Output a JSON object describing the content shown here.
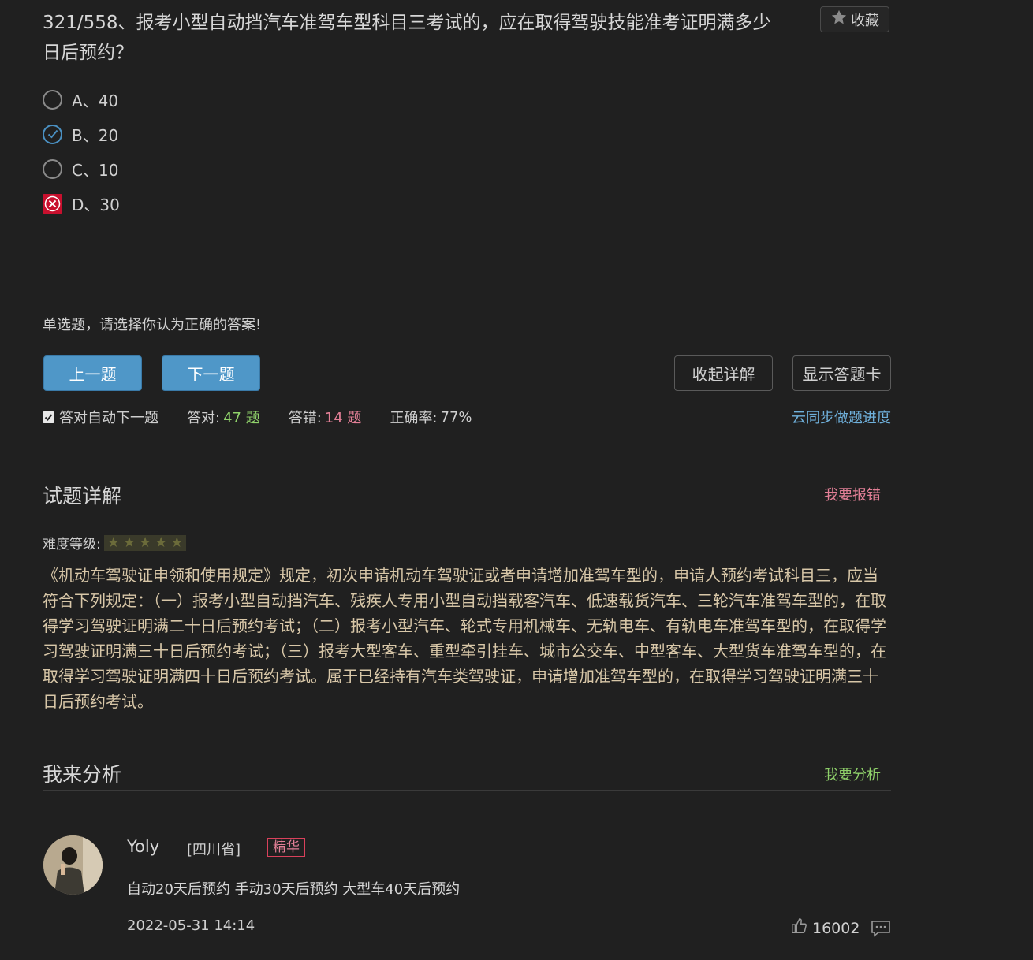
{
  "question": {
    "title": "321/558、报考小型自动挡汽车准驾车型科目三考试的，应在取得驾驶技能准考证明满多少日后预约？",
    "favorite_label": "收藏",
    "options": [
      {
        "label": "A、40",
        "state": "unselected"
      },
      {
        "label": "B、20",
        "state": "correct"
      },
      {
        "label": "C、10",
        "state": "unselected"
      },
      {
        "label": "D、30",
        "state": "wrong"
      }
    ],
    "hint": "单选题，请选择你认为正确的答案!"
  },
  "controls": {
    "prev": "上一题",
    "next": "下一题",
    "collapse": "收起详解",
    "show_card": "显示答题卡"
  },
  "stats": {
    "auto_next_label": "答对自动下一题",
    "auto_next_checked": true,
    "correct_label": "答对:",
    "correct_count": "47 题",
    "wrong_label": "答错:",
    "wrong_count": "14 题",
    "rate_label": "正确率:",
    "rate_value": "77%",
    "sync_link": "云同步做题进度"
  },
  "explanation": {
    "title": "试题详解",
    "report_link": "我要报错",
    "difficulty_label": "难度等级:",
    "difficulty_stars": 5,
    "text": "《机动车驾驶证申领和使用规定》规定，初次申请机动车驾驶证或者申请增加准驾车型的，申请人预约考试科目三，应当符合下列规定：（一）报考小型自动挡汽车、残疾人专用小型自动挡载客汽车、低速载货汽车、三轮汽车准驾车型的，在取得学习驾驶证明满二十日后预约考试；（二）报考小型汽车、轮式专用机械车、无轨电车、有轨电车准驾车型的，在取得学习驾驶证明满三十日后预约考试；（三）报考大型客车、重型牵引挂车、城市公交车、中型客车、大型货车准驾车型的，在取得学习驾驶证明满四十日后预约考试。属于已经持有汽车类驾驶证，申请增加准驾车型的，在取得学习驾驶证明满三十日后预约考试。"
  },
  "analysis": {
    "title": "我来分析",
    "analyze_link": "我要分析",
    "comments": [
      {
        "user": "Yoly",
        "region": "[四川省]",
        "badge": "精华",
        "text": "自动20天后预约 手动30天后预约 大型车40天后预约",
        "time": "2022-05-31 14:14",
        "likes": "16002"
      }
    ]
  },
  "colors": {
    "background": "#202020",
    "primary_button": "#4f97c8",
    "correct_green": "#8fd16a",
    "wrong_pink": "#e27f96",
    "link_blue": "#6fb0db",
    "explain_text": "#d8c7a8"
  }
}
